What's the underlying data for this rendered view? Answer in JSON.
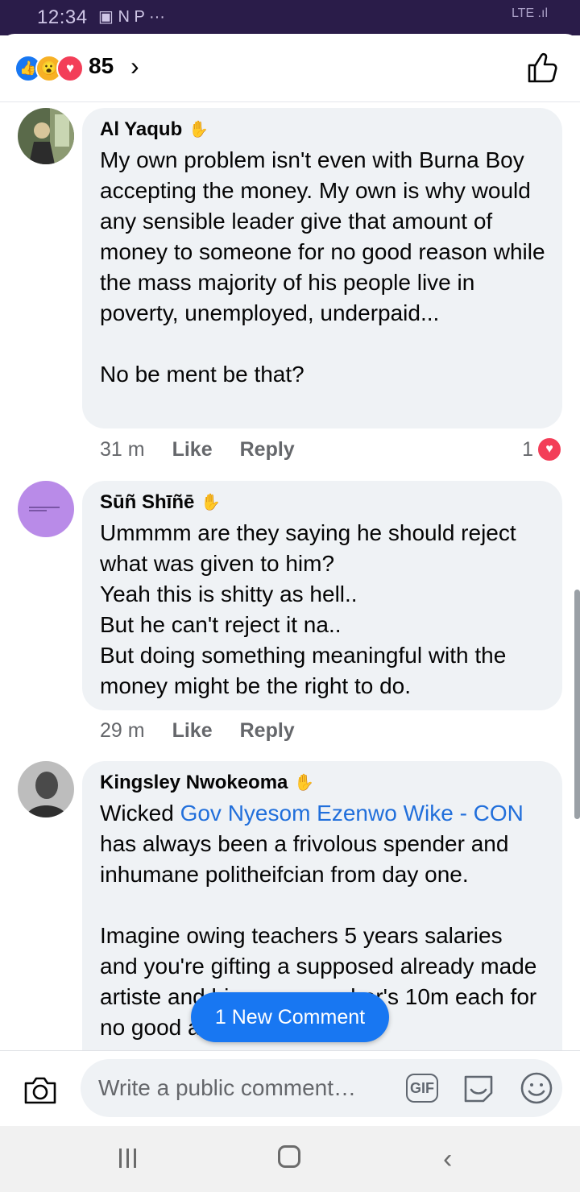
{
  "status_bar": {
    "time": "12:34",
    "left_icons": "▣ N P ···",
    "right_icons": "LTE .ıl"
  },
  "reactions": {
    "count": "85"
  },
  "comments": [
    {
      "author": "Al Yaqub",
      "text": "My own problem isn't even with Burna Boy accepting the money. My own is why would any sensible leader give that amount of money to someone for no good reason while the mass majority of his people live in poverty, unemployed, underpaid...\n\nNo be ment be that?",
      "time": "31 m",
      "like": "Like",
      "reply": "Reply",
      "reaction_count": "1"
    },
    {
      "author": "Sūñ Shīñē",
      "text": "Ummmm are they saying he should reject what was given to him?\nYeah this is shitty as hell..\nBut he can't reject it na..\nBut doing something meaningful with the money might be the right to do.",
      "time": "29 m",
      "like": "Like",
      "reply": "Reply"
    },
    {
      "author": "Kingsley Nwokeoma",
      "text_before": "Wicked ",
      "mention": "Gov Nyesom Ezenwo Wike - CON",
      "text_after": " has always been a frivolous spender and inhumane politheifcian from day one.\n\nImagine owing teachers 5 years salaries and you're gifting a supposed already made artiste and his crew member's 10m each for no good activities"
    }
  ],
  "new_comment_label": "1 New Comment",
  "composer": {
    "placeholder": "Write a public comment…",
    "gif_label": "GIF"
  },
  "colors": {
    "accent": "#1877f2",
    "bubble": "#eff2f5",
    "status_bar": "#2a1c49",
    "mention": "#216fdb"
  }
}
